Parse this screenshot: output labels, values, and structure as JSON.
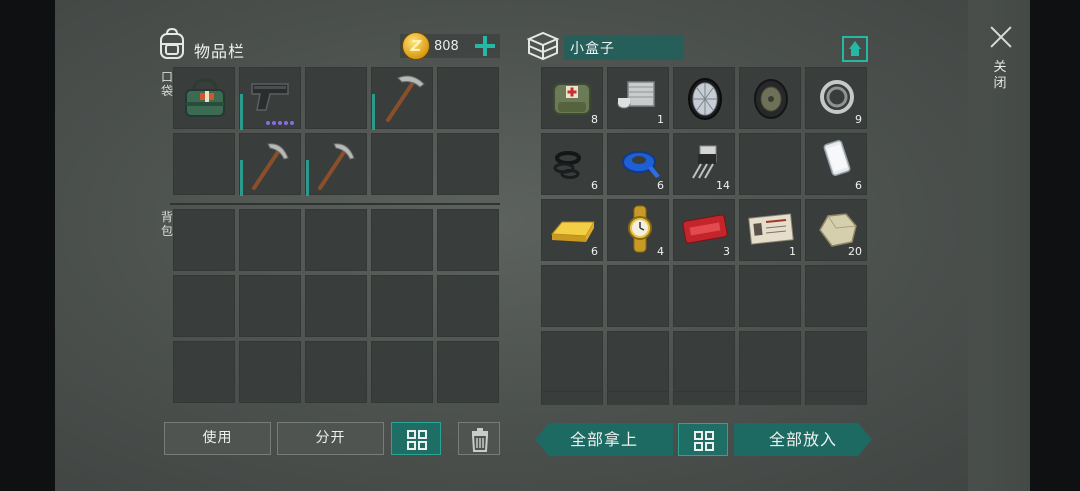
{
  "inventory": {
    "title": "物品栏",
    "coins": "808",
    "pocket_label": "口袋",
    "backpack_label": "背包",
    "pocket_slots": [
      {
        "item": "green-medical-bag",
        "count": ""
      },
      {
        "item": "pistol",
        "count": ""
      },
      {
        "item": "empty",
        "count": ""
      },
      {
        "item": "pickaxe",
        "count": ""
      },
      {
        "item": "empty",
        "count": ""
      },
      {
        "item": "empty",
        "count": ""
      },
      {
        "item": "pickaxe",
        "count": ""
      },
      {
        "item": "pickaxe",
        "count": ""
      },
      {
        "item": "empty",
        "count": ""
      },
      {
        "item": "empty",
        "count": ""
      }
    ]
  },
  "container": {
    "name": "小盒子",
    "slots": [
      {
        "item": "medical-bag",
        "count": "8"
      },
      {
        "item": "engine-cylinder",
        "count": "1"
      },
      {
        "item": "wheel",
        "count": ""
      },
      {
        "item": "tire-hub",
        "count": ""
      },
      {
        "item": "bearing",
        "count": "9"
      },
      {
        "item": "rubber-seals",
        "count": "6"
      },
      {
        "item": "blue-tape",
        "count": "6"
      },
      {
        "item": "transistor",
        "count": "14"
      },
      {
        "item": "empty",
        "count": ""
      },
      {
        "item": "smartphone",
        "count": "6"
      },
      {
        "item": "gold-bar",
        "count": "6"
      },
      {
        "item": "gold-watch",
        "count": "4"
      },
      {
        "item": "coupon-ticket",
        "count": "3"
      },
      {
        "item": "army-id-card",
        "count": "1"
      },
      {
        "item": "stone",
        "count": "20"
      }
    ]
  },
  "buttons": {
    "use": "使用",
    "split": "分开",
    "take_all": "全部拿上",
    "put_all": "全部放入",
    "close": "关闭"
  },
  "colors": {
    "accent_teal": "#25b8a4",
    "button_teal": "#1d6a62",
    "slot_bg": "#393d3b",
    "rarity_purple": "#8a6be0"
  }
}
